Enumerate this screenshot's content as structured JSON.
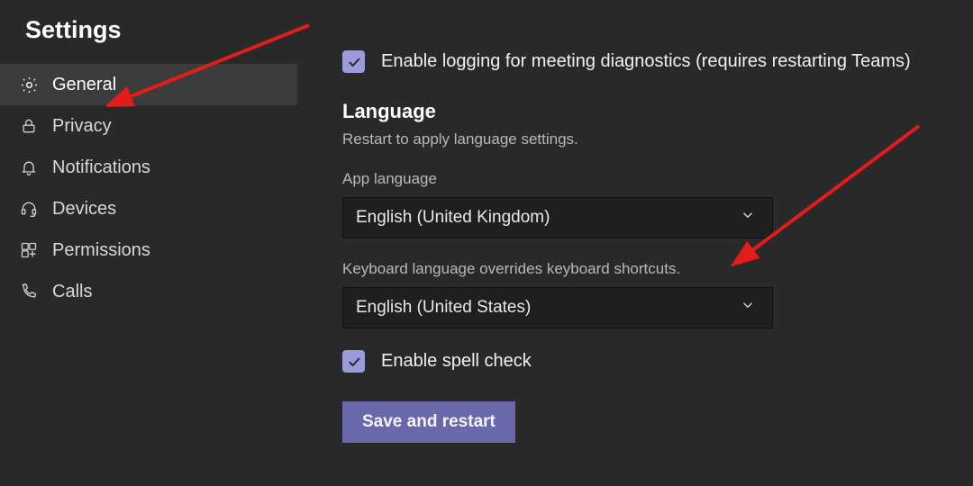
{
  "title": "Settings",
  "sidebar": {
    "items": [
      {
        "label": "General",
        "icon": "gear",
        "selected": true
      },
      {
        "label": "Privacy",
        "icon": "lock",
        "selected": false
      },
      {
        "label": "Notifications",
        "icon": "bell",
        "selected": false
      },
      {
        "label": "Devices",
        "icon": "headset",
        "selected": false
      },
      {
        "label": "Permissions",
        "icon": "apps",
        "selected": false
      },
      {
        "label": "Calls",
        "icon": "phone",
        "selected": false
      }
    ]
  },
  "main": {
    "enable_logging": {
      "checked": true,
      "label": "Enable logging for meeting diagnostics (requires restarting Teams)"
    },
    "language": {
      "section_title": "Language",
      "hint": "Restart to apply language settings.",
      "app_language": {
        "label": "App language",
        "value": "English (United Kingdom)"
      },
      "keyboard_hint": "Keyboard language overrides keyboard shortcuts.",
      "keyboard_language": {
        "value": "English (United States)"
      },
      "spellcheck": {
        "checked": true,
        "label": "Enable spell check"
      },
      "save_button": "Save and restart"
    }
  }
}
